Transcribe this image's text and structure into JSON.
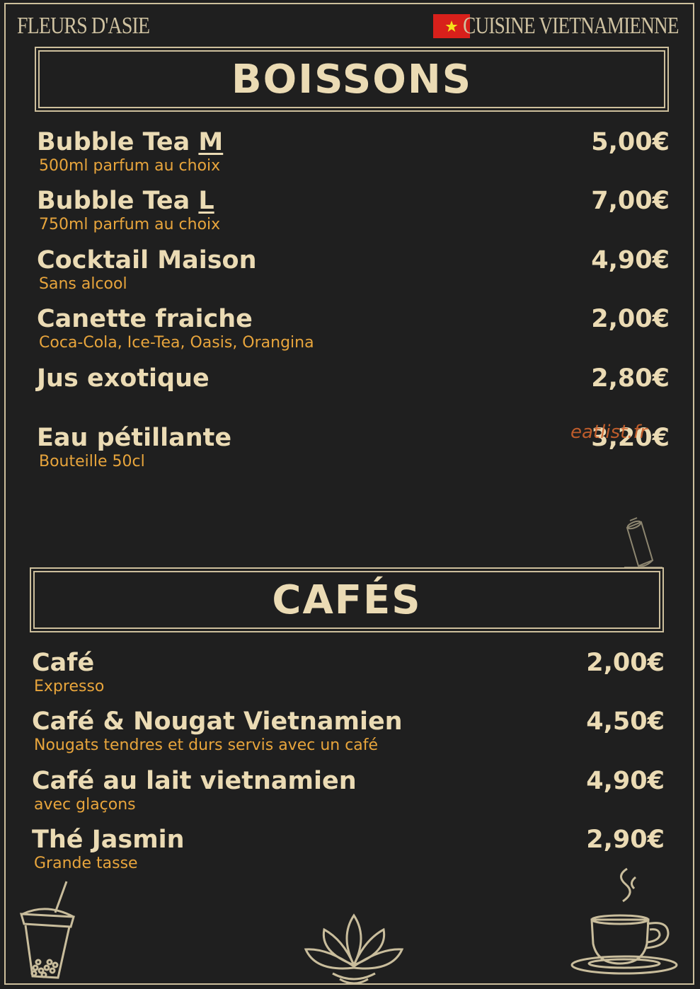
{
  "header": {
    "brand": "FLEURS D'ASIE",
    "cuisine": "CUISINE VIETNAMIENNE",
    "flag_colors": {
      "field": "#d8201b",
      "star": "#f4e01b"
    }
  },
  "boissons": {
    "title": "BOISSONS",
    "items": [
      {
        "name": "Bubble Tea ",
        "size": "M",
        "desc": "500ml parfum au choix",
        "price": "5,00€"
      },
      {
        "name": "Bubble Tea ",
        "size": "L",
        "desc": "750ml parfum au choix",
        "price": "7,00€"
      },
      {
        "name": "Cocktail Maison",
        "desc": "Sans alcool",
        "price": "4,90€"
      },
      {
        "name": "Canette fraiche",
        "desc": "Coca-Cola, Ice-Tea, Oasis, Orangina",
        "price": "2,00€"
      },
      {
        "name": "Jus exotique",
        "price": "2,80€"
      },
      {
        "name": "Eau pétillante",
        "desc": "Bouteille 50cl",
        "price": "3,20€"
      }
    ]
  },
  "cafes": {
    "title": "CAFÉS",
    "items": [
      {
        "name": "Café",
        "desc": "Expresso",
        "price": "2,00€"
      },
      {
        "name": "Café & Nougat Vietnamien",
        "desc": "Nougats tendres et durs servis avec un café",
        "price": "4,50€"
      },
      {
        "name": "Café au lait vietnamien",
        "desc": "avec glaçons",
        "price": "4,90€"
      },
      {
        "name": "Thé Jasmin",
        "desc": "Grande tasse",
        "price": "2,90€"
      }
    ]
  },
  "watermark": "eatlist.fr",
  "icons": [
    "can-icon",
    "bubble-tea-icon",
    "lotus-icon",
    "coffee-cup-icon"
  ],
  "colors": {
    "background": "#1f1f1f",
    "text": "#ebdbb4",
    "desc": "#e8a53c",
    "border": "#cdbf9c"
  }
}
